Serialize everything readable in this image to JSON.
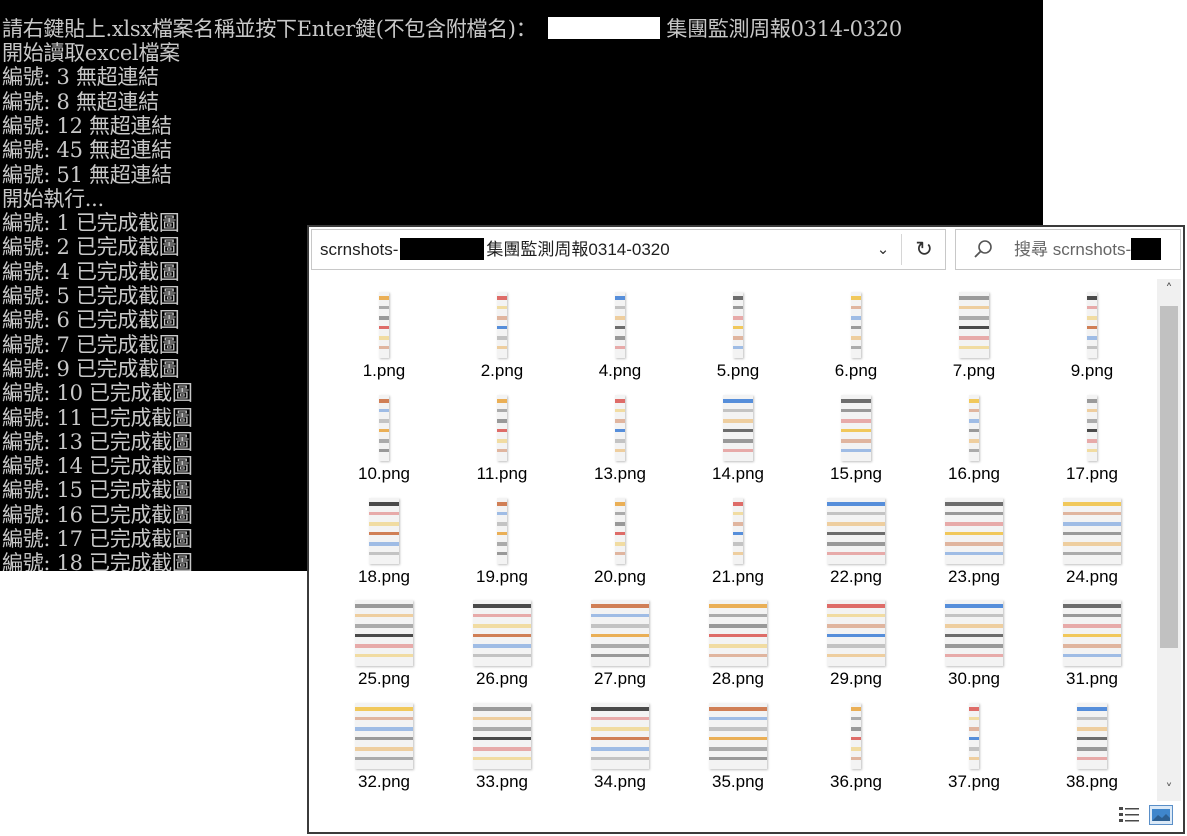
{
  "console": {
    "prompt_before": "請右鍵貼上.xlsx檔案名稱並按下Enter鍵(不包含附檔名)：",
    "prompt_after": "集團監測周報0314-0320",
    "lines": [
      "開始讀取excel檔案",
      "編號: 3 無超連結",
      "編號: 8 無超連結",
      "編號: 12 無超連結",
      "編號: 45 無超連結",
      "編號: 51 無超連結",
      "開始執行...",
      "編號: 1 已完成截圖",
      "編號: 2 已完成截圖",
      "編號: 4 已完成截圖",
      "編號: 5 已完成截圖",
      "編號: 6 已完成截圖",
      "編號: 7 已完成截圖",
      "編號: 9 已完成截圖",
      "編號: 10 已完成截圖",
      "編號: 11 已完成截圖",
      "編號: 13 已完成截圖",
      "編號: 14 已完成截圖",
      "編號: 15 已完成截圖",
      "編號: 16 已完成截圖",
      "編號: 17 已完成截圖",
      "編號: 18 已完成截圖"
    ]
  },
  "explorer": {
    "address_prefix": "scrnshots-",
    "address_suffix": "集團監測周報0314-0320",
    "search_placeholder": "搜尋 scrnshots-",
    "files": [
      {
        "name": "1.png",
        "type": "tall"
      },
      {
        "name": "2.png",
        "type": "tall"
      },
      {
        "name": "4.png",
        "type": "tall"
      },
      {
        "name": "5.png",
        "type": "tall"
      },
      {
        "name": "6.png",
        "type": "tall"
      },
      {
        "name": "7.png",
        "type": "mid"
      },
      {
        "name": "9.png",
        "type": "tall"
      },
      {
        "name": "10.png",
        "type": "tall"
      },
      {
        "name": "11.png",
        "type": "tall"
      },
      {
        "name": "13.png",
        "type": "tall"
      },
      {
        "name": "14.png",
        "type": "mid"
      },
      {
        "name": "15.png",
        "type": "mid"
      },
      {
        "name": "16.png",
        "type": "tall"
      },
      {
        "name": "17.png",
        "type": "tall"
      },
      {
        "name": "18.png",
        "type": "mid"
      },
      {
        "name": "19.png",
        "type": "tall"
      },
      {
        "name": "20.png",
        "type": "tall"
      },
      {
        "name": "21.png",
        "type": "tall"
      },
      {
        "name": "22.png",
        "type": "wide"
      },
      {
        "name": "23.png",
        "type": "wide"
      },
      {
        "name": "24.png",
        "type": "wide"
      },
      {
        "name": "25.png",
        "type": "wide"
      },
      {
        "name": "26.png",
        "type": "wide"
      },
      {
        "name": "27.png",
        "type": "wide"
      },
      {
        "name": "28.png",
        "type": "wide"
      },
      {
        "name": "29.png",
        "type": "wide"
      },
      {
        "name": "30.png",
        "type": "wide"
      },
      {
        "name": "31.png",
        "type": "wide"
      },
      {
        "name": "32.png",
        "type": "wide"
      },
      {
        "name": "33.png",
        "type": "wide"
      },
      {
        "name": "34.png",
        "type": "wide"
      },
      {
        "name": "35.png",
        "type": "wide"
      },
      {
        "name": "36.png",
        "type": "tall"
      },
      {
        "name": "37.png",
        "type": "tall"
      },
      {
        "name": "38.png",
        "type": "mid"
      }
    ],
    "accent_colors": [
      "#e8a23a",
      "#d9534f",
      "#3a7bd5",
      "#555555",
      "#f0c040",
      "#8a8a8a",
      "#2c2c2c",
      "#c96a3a"
    ]
  },
  "icons": {
    "chevron": "chevron-down-icon",
    "refresh": "refresh-icon",
    "search": "search-icon",
    "details_view": "details-view-icon",
    "large_icons_view": "large-icons-view-icon"
  }
}
